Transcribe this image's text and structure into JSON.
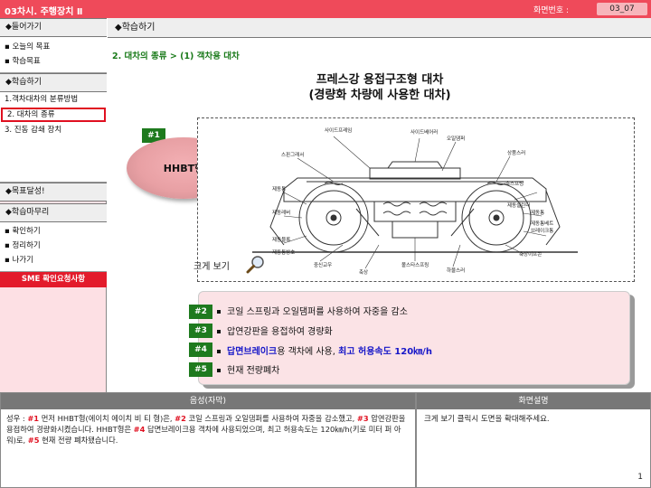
{
  "header": {
    "title": "03차시. 주행장치 Ⅱ",
    "screen_label": "화면번호 :",
    "screen_number": "03_07"
  },
  "sidebar": {
    "intro": "◆들어가기",
    "intro_items": [
      "▪ 오늘의 목표",
      "▪ 학습목표"
    ],
    "learn": "◆학습하기",
    "learn_items": [
      "1.객차대차의 분류방법",
      "2. 대차의 종류",
      "3. 진동 감쇄 장치"
    ],
    "goal": "◆목표달성!",
    "wrap": "◆학습마무리",
    "wrap_items": [
      "▪ 확인하기",
      "▪ 정리하기",
      "▪ 나가기"
    ],
    "sme": "SME 확인요청사항"
  },
  "main": {
    "section": "◆학습하기",
    "breadcrumb": "2. 대차의 종류  >  (1) 객차용 대차",
    "title_line1": "프레스강 용접구조형 대차",
    "title_line2": "(경량화 차량에 사용한 대차)",
    "tags": [
      "#1",
      "#2",
      "#3",
      "#4",
      "#5"
    ],
    "oval_label": "HHBT형",
    "zoom_label": "크게 보기",
    "bullets": {
      "b1": "코일 스프링과 오일댐퍼를 사용하여 자중을 감소",
      "b2": "압연강판을 용접하여 경량화",
      "b3_a": "답면브레이크",
      "b3_b": "용 객차에 사용, ",
      "b3_c": "최고 허용속도 120㎞/h",
      "b4": "현재 전량폐차"
    },
    "diagram_labels": [
      "사이드프레임",
      "사이드베어러",
      "오일댐퍼",
      "상품스러",
      "스핀그래서",
      "축스프링",
      "제동통",
      "제동레버",
      "제동블록",
      "제동실린더",
      "제동통",
      "제동통베트",
      "브레이크통",
      "축상이프콘",
      "제동통방호",
      "중신교우",
      "볼스타스프링",
      "축상",
      "하물스러"
    ]
  },
  "narration": {
    "header": "음성(자막)",
    "p1": "성우 : ",
    "t1": "#1",
    "p2": " 먼저 HHBT형(에이치 에이치 비 티 형)은, ",
    "t2": "#2",
    "p3": " 코일 스프링과 오일댐퍼를 사용하여 자중을 감소했고, ",
    "t3": "#3",
    "p4": " 압연강판을 용접하여 경량화시켰습니다. HHBT형은 ",
    "t4": "#4",
    "p5": " 답면브레이크용 객차에 사용되었으며, 최고 허용속도는 120㎞/h(키로 미터 퍼 아워)로, ",
    "t5": "#5",
    "p6": " 현재 전량 폐차됐습니다."
  },
  "screen_desc": {
    "header": "화면설명",
    "text": "크게 보기 클릭시 도면을 확대해주세요.",
    "page": "1"
  },
  "colors": {
    "topbar": "#ef4a5a",
    "tag_green": "#1e7a1e",
    "highlight_blue": "#1616c8",
    "sme_red": "#e31b2b"
  }
}
